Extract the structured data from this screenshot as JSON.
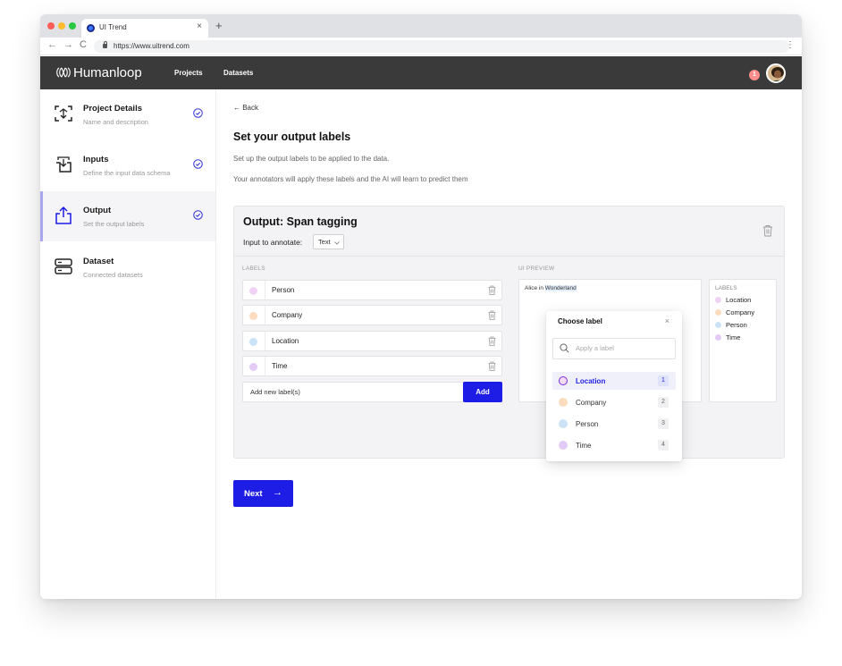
{
  "browser": {
    "tab_title": "UI Trend",
    "tab_close": "×",
    "new_tab": "+",
    "url": "https://www.uitrend.com",
    "nav": {
      "back": "←",
      "forward": "→",
      "reload": "C"
    },
    "menu": "⋮"
  },
  "header": {
    "brand": "Humanloop",
    "nav": [
      "Projects",
      "Datasets"
    ],
    "notification_count": "1"
  },
  "sidebar": {
    "steps": [
      {
        "title": "Project Details",
        "subtitle": "Name and description",
        "completed": true
      },
      {
        "title": "Inputs",
        "subtitle": "Define the input data schema",
        "completed": true
      },
      {
        "title": "Output",
        "subtitle": "Set the output labels",
        "completed": true,
        "active": true
      },
      {
        "title": "Dataset",
        "subtitle": "Connected datasets",
        "completed": false
      }
    ]
  },
  "main": {
    "back": "← Back",
    "title": "Set your output labels",
    "description_1": "Set up the output labels to be applied to the data.",
    "description_2": "Your annotators will apply these labels and the AI will learn to predict them",
    "card": {
      "title": "Output: Span tagging",
      "input_label": "Input to annotate:",
      "input_value": "Text",
      "labels_header": "LABELS",
      "labels": [
        {
          "name": "Person",
          "color": "#f0d2f5"
        },
        {
          "name": "Company",
          "color": "#fbdcbf"
        },
        {
          "name": "Location",
          "color": "#cbe3f6"
        },
        {
          "name": "Time",
          "color": "#e3cbf5"
        }
      ],
      "add_placeholder": "Add new label(s)",
      "add_button": "Add",
      "preview_header": "UI PREVIEW",
      "preview_text_plain": "Alice in ",
      "preview_text_highlight": "Wonderland",
      "legend_header": "LABELS",
      "legend": [
        {
          "name": "Location",
          "color": "#f0d2f5"
        },
        {
          "name": "Company",
          "color": "#fbdcbf"
        },
        {
          "name": "Person",
          "color": "#cbe3f6"
        },
        {
          "name": "Time",
          "color": "#e3cbf5"
        }
      ]
    },
    "dropdown": {
      "title": "Choose label",
      "close": "×",
      "search_placeholder": "Apply a label",
      "items": [
        {
          "name": "Location",
          "key": "1",
          "color": "#f1dbf9",
          "selected": true
        },
        {
          "name": "Company",
          "key": "2",
          "color": "#fbdcbf",
          "selected": false
        },
        {
          "name": "Person",
          "key": "3",
          "color": "#cbe3f6",
          "selected": false
        },
        {
          "name": "Time",
          "key": "4",
          "color": "#e3cbf5",
          "selected": false
        }
      ]
    },
    "next_button": "Next",
    "next_arrow": "→"
  },
  "colors": {
    "accent": "#1d1de6",
    "header_bg": "#3a3a3a",
    "active_step_border": "#a8a6ec"
  }
}
